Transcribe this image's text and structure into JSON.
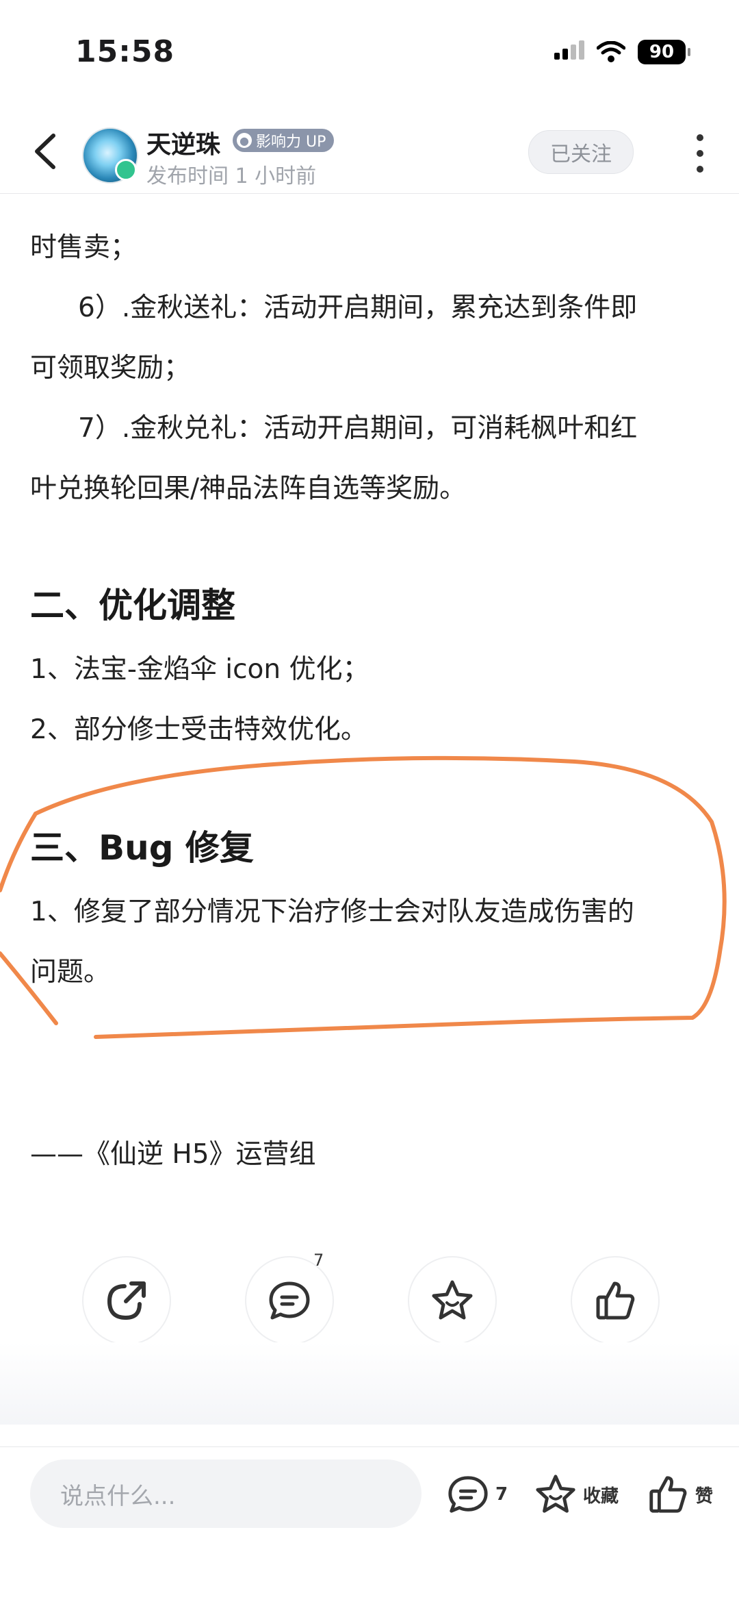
{
  "status_bar": {
    "time": "15:58",
    "battery": "90"
  },
  "header": {
    "author_name": "天逆珠",
    "influence_badge": "影响力 UP",
    "publish_time": "发布时间 1 小时前",
    "follow_label": "已关注"
  },
  "article": {
    "lines": [
      "时售卖；",
      "6）.金秋送礼：活动开启期间，累充达到条件即",
      "可领取奖励；",
      "7）.金秋兑礼：活动开启期间，可消耗枫叶和红",
      "叶兑换轮回果/神品法阵自选等奖励。"
    ],
    "section2": {
      "heading": "二、优化调整",
      "items": [
        "1、法宝-金焰伞 icon 优化；",
        "2、部分修士受击特效优化。"
      ]
    },
    "section3": {
      "heading": "三、Bug 修复",
      "lines": [
        "1、修复了部分情况下治疗修士会对队友造成伤害的",
        "问题。"
      ]
    },
    "signature": "——《仙逆 H5》运营组"
  },
  "actions": {
    "comment_count": "7"
  },
  "bottom_bar": {
    "input_placeholder": "说点什么...",
    "comment_count": "7",
    "collect_label": "收藏",
    "like_label": "赞"
  },
  "colors": {
    "annotation": "#f0884a",
    "badge": "#8b95aa",
    "verified": "#32c48f"
  }
}
